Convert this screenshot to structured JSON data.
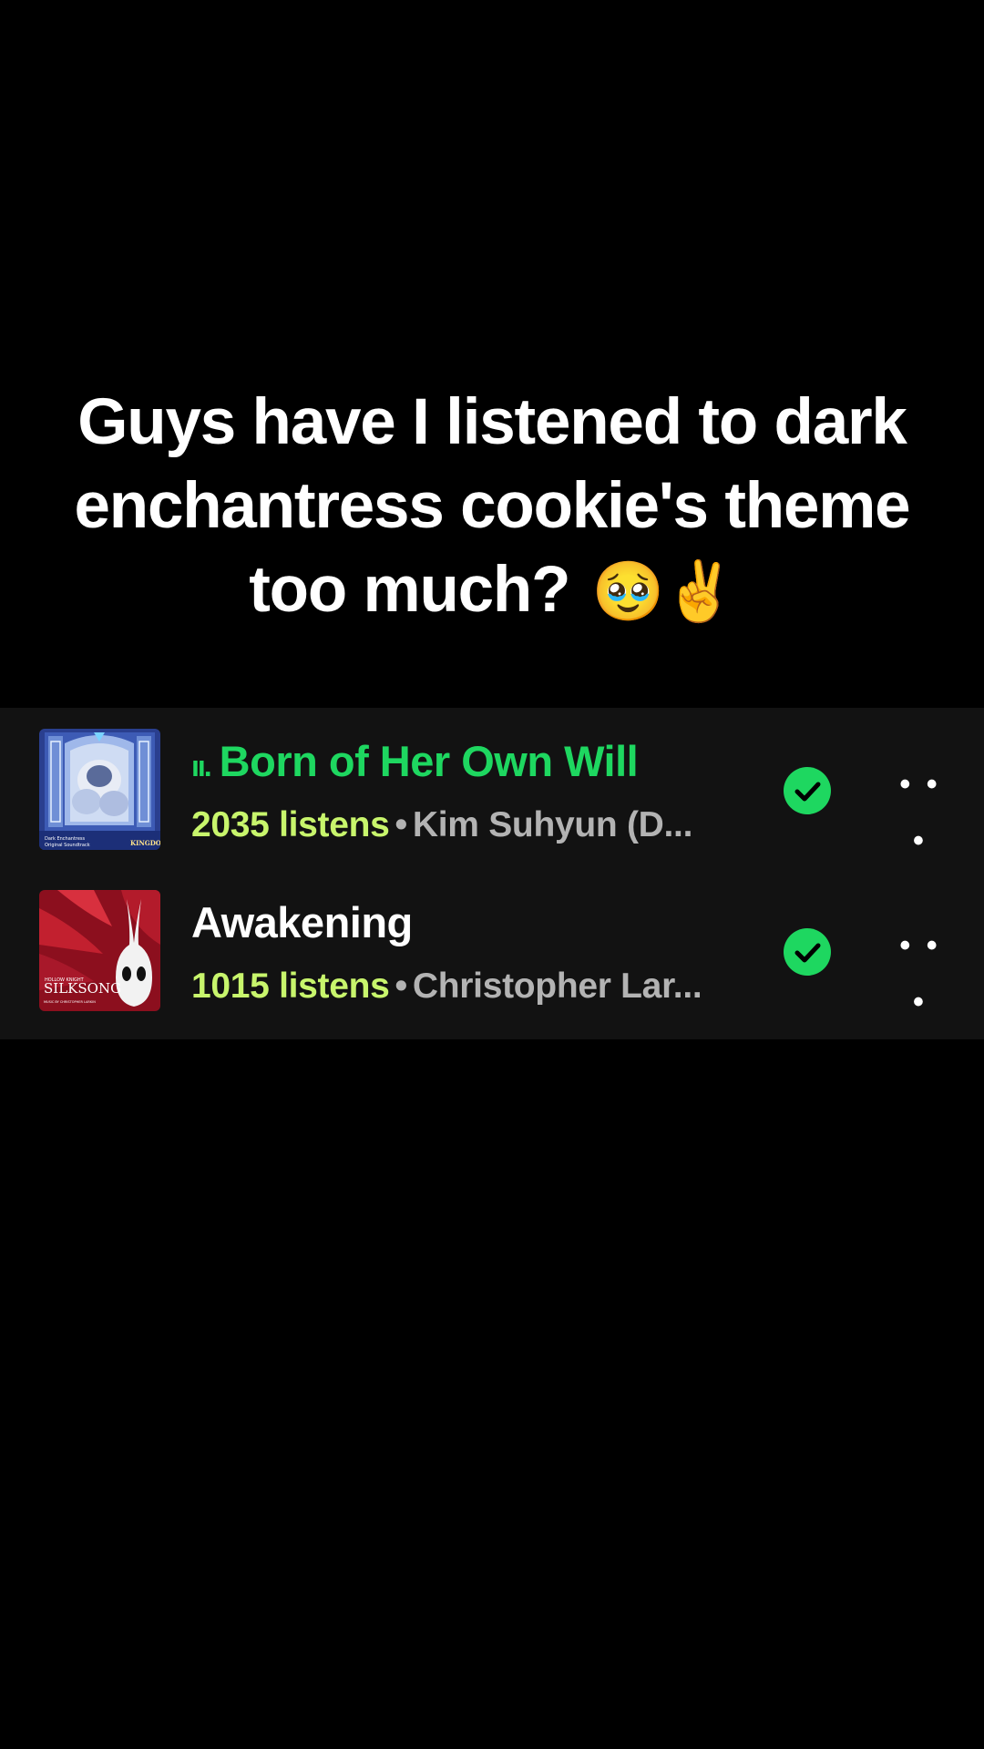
{
  "caption": {
    "text": "Guys have I listened to dark enchantress cookie's theme too much?",
    "emoji": "🥹✌️"
  },
  "tracks": [
    {
      "title": "Born of Her Own Will",
      "playing_indicator": "ıı.",
      "listens": "2035 listens",
      "separator": "•",
      "artist": "Kim Suhyun (D...",
      "art_icon": "cookierun-kingdom-album-art",
      "art_text_left": "Dark Enchantress Original Soundtrack",
      "art_text_right": "KINGDOM",
      "downloaded": true,
      "more_label": "• • •"
    },
    {
      "title": "Awakening",
      "listens": "1015 listens",
      "separator": "•",
      "artist": "Christopher Lar...",
      "art_icon": "hollow-knight-silksong-album-art",
      "art_text_top": "HOLLOW KNIGHT",
      "art_text_main": "SILKSONG",
      "art_text_bottom": "MUSIC BY CHRISTOPHER LARKIN",
      "downloaded": true,
      "more_label": "• • •"
    }
  ],
  "colors": {
    "background": "#000000",
    "panel": "#121212",
    "accent_green": "#1ed760",
    "listens_lime": "#c8f56c",
    "secondary_text": "#b3b3b3"
  }
}
